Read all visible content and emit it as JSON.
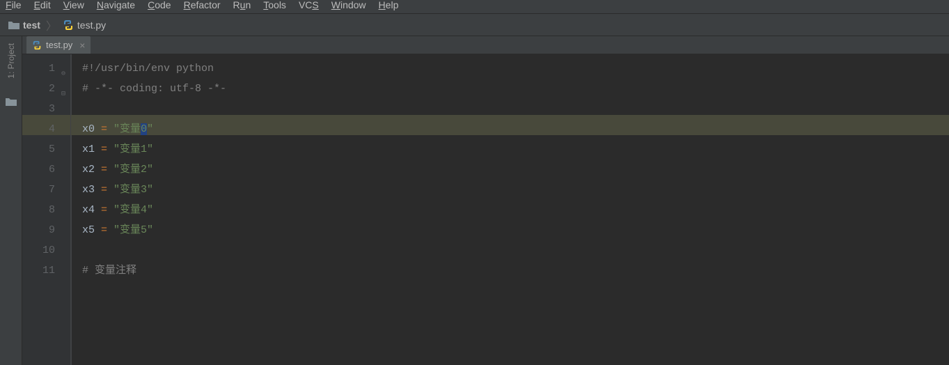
{
  "menubar": {
    "items": [
      {
        "u": "F",
        "rest": "ile"
      },
      {
        "u": "E",
        "rest": "dit"
      },
      {
        "u": "V",
        "rest": "iew"
      },
      {
        "u": "N",
        "rest": "avigate"
      },
      {
        "u": "C",
        "rest": "ode"
      },
      {
        "u": "R",
        "rest": "efactor"
      },
      {
        "u": "R",
        "mid": "u",
        "rest": "n"
      },
      {
        "u": "T",
        "rest": "ools"
      },
      {
        "pre": "VC",
        "u": "S",
        "rest": ""
      },
      {
        "u": "W",
        "rest": "indow"
      },
      {
        "u": "H",
        "rest": "elp"
      }
    ]
  },
  "breadcrumb": {
    "folder": "test",
    "file": "test.py"
  },
  "tab": {
    "filename": "test.py"
  },
  "sidebar": {
    "project_label": "1: Project"
  },
  "code": {
    "highlighted_line": 4,
    "lines": [
      {
        "n": 1,
        "type": "comment",
        "text": "#!/usr/bin/env python"
      },
      {
        "n": 2,
        "type": "comment",
        "text": "# -*- coding: utf-8 -*-"
      },
      {
        "n": 3,
        "type": "blank",
        "text": ""
      },
      {
        "n": 4,
        "type": "assign",
        "var": "x0",
        "op": "=",
        "str": "\"变量0\"",
        "selected": "0"
      },
      {
        "n": 5,
        "type": "assign",
        "var": "x1",
        "op": "=",
        "str": "\"变量1\""
      },
      {
        "n": 6,
        "type": "assign",
        "var": "x2",
        "op": "=",
        "str": "\"变量2\""
      },
      {
        "n": 7,
        "type": "assign",
        "var": "x3",
        "op": "=",
        "str": "\"变量3\""
      },
      {
        "n": 8,
        "type": "assign",
        "var": "x4",
        "op": "=",
        "str": "\"变量4\""
      },
      {
        "n": 9,
        "type": "assign",
        "var": "x5",
        "op": "=",
        "str": "\"变量5\""
      },
      {
        "n": 10,
        "type": "blank",
        "text": ""
      },
      {
        "n": 11,
        "type": "comment",
        "text": "# 变量注释"
      }
    ]
  }
}
